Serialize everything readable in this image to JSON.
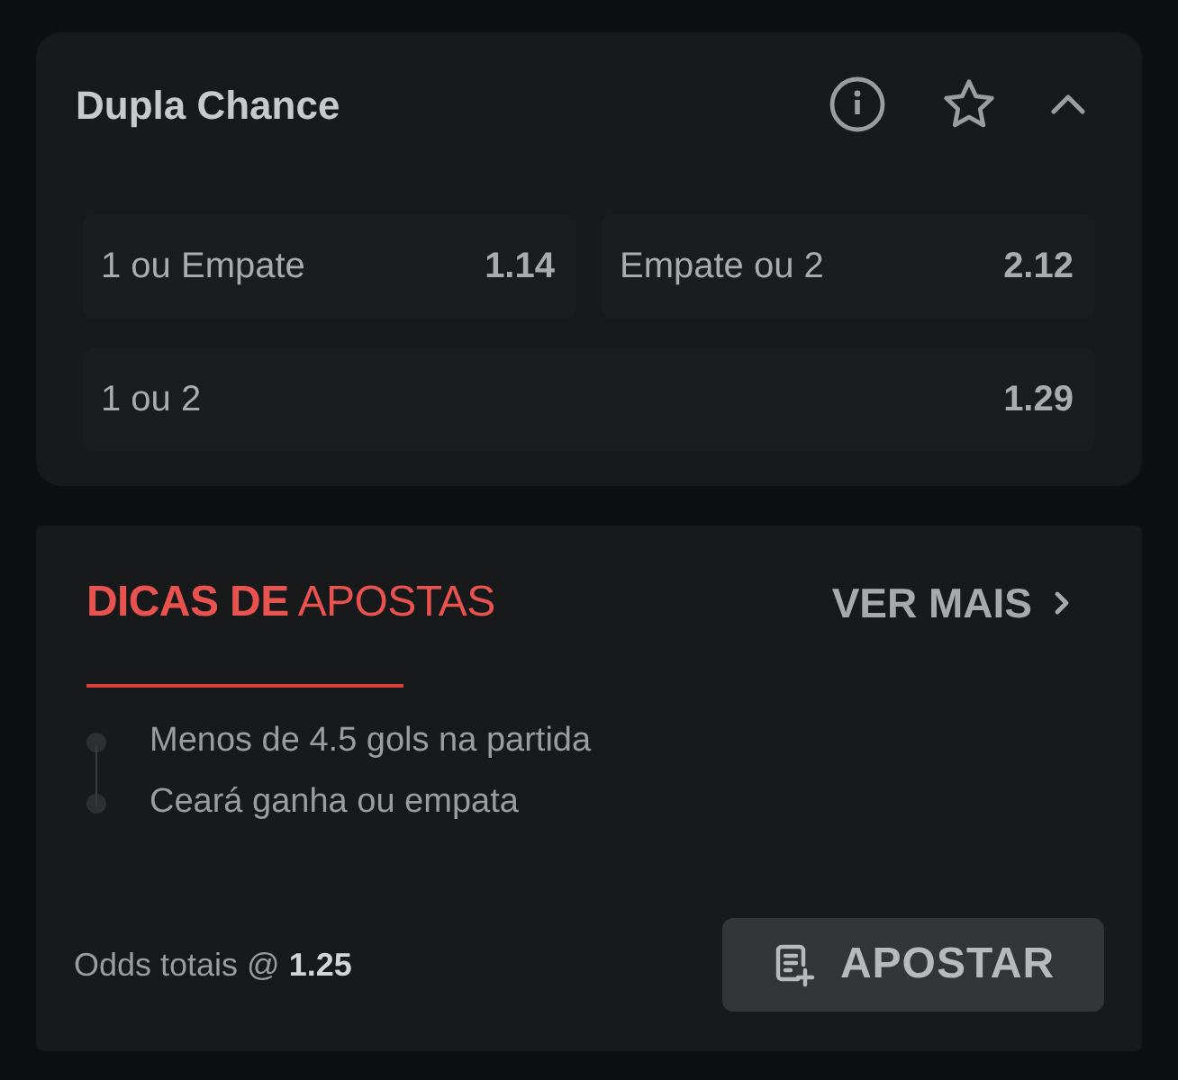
{
  "market": {
    "title": "Dupla Chance",
    "expanded": true,
    "rows": [
      [
        {
          "label": "1 ou Empate",
          "odds": "1.14"
        },
        {
          "label": "Empate ou 2",
          "odds": "2.12"
        }
      ],
      [
        {
          "label": "1 ou 2",
          "odds": "1.29"
        }
      ]
    ]
  },
  "tips": {
    "title": "**DICAS DE** APOSTAS",
    "more": "VER MAIS",
    "items": [
      "Menos de 4.5 gols na partida",
      "Ceará ganha ou empata"
    ],
    "total": "Odds totais @ **1.25**",
    "button": "APOSTAR"
  }
}
